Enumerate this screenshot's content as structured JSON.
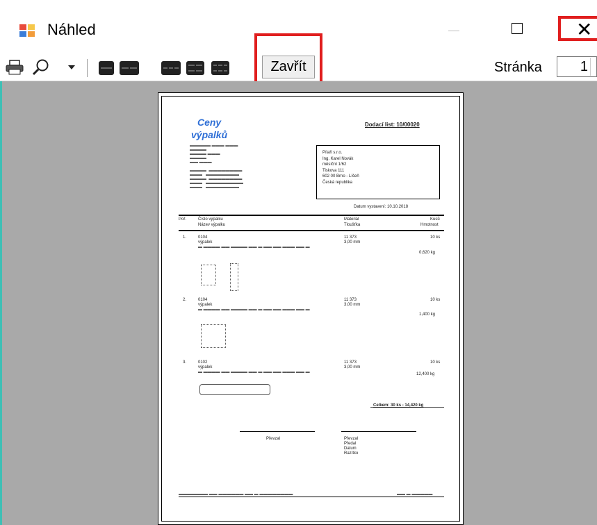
{
  "window": {
    "title": "Náhled"
  },
  "toolbar": {
    "close_label": "Zavřít",
    "page_label": "Stránka",
    "page_value": "1"
  },
  "icons": [
    "print-icon",
    "zoom-icon",
    "chevron-down-icon",
    "one-page-icon",
    "two-pages-icon",
    "three-pages-icon",
    "four-pages-icon",
    "six-pages-icon",
    "minimize-icon",
    "maximize-icon",
    "close-icon"
  ],
  "colors": {
    "highlight": "#e01e1e",
    "brand": "#2f6fd6",
    "background": "#a9a9a9"
  },
  "document": {
    "brand_line1": "Ceny",
    "brand_line2": "výpalků",
    "title": "Dodací list: 10/00020",
    "customer": [
      "Pílaři s.r.o.",
      "Ing. Karel Novák",
      "měsíční 1/62",
      "Tiskova 111",
      "602 00 Brno - Líšeň",
      "Česká republika"
    ],
    "date_line": "Datum vystavení: 10.10.2018",
    "col_headers": [
      "Poř.",
      "Číslo výpalku",
      "Název výpalku",
      "Materiál",
      "Tloušťka",
      "Kusů",
      "Hmotnost"
    ],
    "items": [
      {
        "no": "1.",
        "code": "0104",
        "name": "výpalek",
        "material": "11 373",
        "thickness": "3,00 mm",
        "qty": "10 ks",
        "weight": "0,620 kg"
      },
      {
        "no": "2.",
        "code": "0104",
        "name": "výpalek",
        "material": "11 373",
        "thickness": "3,00 mm",
        "qty": "10 ks",
        "weight": "1,400 kg"
      },
      {
        "no": "3.",
        "code": "0102",
        "name": "výpalek",
        "material": "11 373",
        "thickness": "3,00 mm",
        "qty": "10 ks",
        "weight": "12,400 kg"
      }
    ],
    "total": "Celkem: 30 ks  -  14,420 kg",
    "sign_left": "Převzal",
    "sign_right": [
      "Převzal",
      "Předal",
      "Datum",
      "Razítko"
    ]
  }
}
